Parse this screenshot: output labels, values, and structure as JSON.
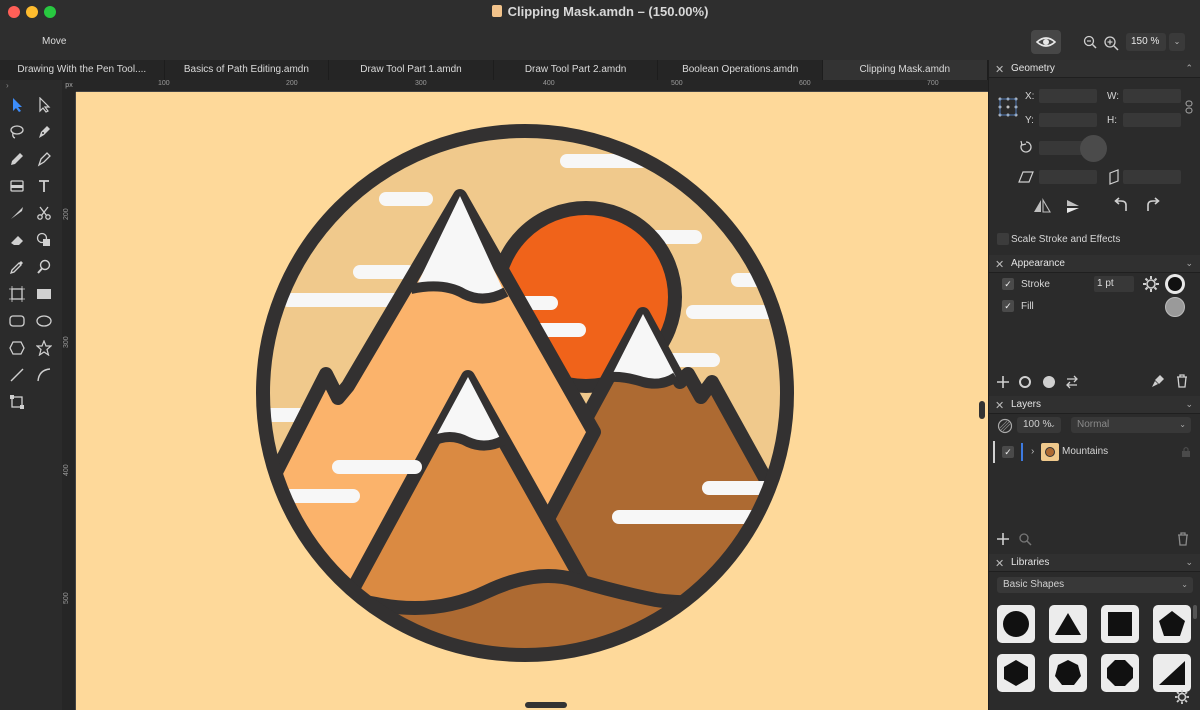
{
  "window": {
    "title": "Clipping Mask.amdn – (150.00%)"
  },
  "toolbar": {
    "tool_name": "Move",
    "zoom_value": "150 %"
  },
  "tabs": [
    {
      "label": "Drawing With the Pen Tool...."
    },
    {
      "label": "Basics of Path Editing.amdn"
    },
    {
      "label": "Draw Tool Part 1.amdn"
    },
    {
      "label": "Draw Tool Part 2.amdn"
    },
    {
      "label": "Boolean Operations.amdn"
    },
    {
      "label": "Clipping Mask.amdn"
    }
  ],
  "rulers": {
    "unit": "px",
    "top_ticks": [
      "100",
      "200",
      "300",
      "400",
      "500",
      "600",
      "700"
    ],
    "left_ticks": [
      "200",
      "300",
      "400",
      "500"
    ]
  },
  "geometry": {
    "title": "Geometry",
    "x_label": "X:",
    "y_label": "Y:",
    "w_label": "W:",
    "h_label": "H:",
    "scale_stroke_label": "Scale Stroke and Effects"
  },
  "appearance": {
    "title": "Appearance",
    "stroke_label": "Stroke",
    "stroke_width": "1 pt",
    "fill_label": "Fill"
  },
  "layers": {
    "title": "Layers",
    "opacity": "100 %",
    "blend_mode": "Normal",
    "items": [
      {
        "name": "Mountains"
      }
    ]
  },
  "libraries": {
    "title": "Libraries",
    "selected": "Basic Shapes"
  },
  "colors": {
    "canvas_bg": "#fed99a",
    "sky": "#f0c98c",
    "sun": "#f0631a",
    "outline": "#333131",
    "mountain_light": "#fbb36b",
    "mountain_mid": "#da8a42",
    "mountain_dark": "#ad6a32",
    "snow": "#f7f7f7"
  }
}
